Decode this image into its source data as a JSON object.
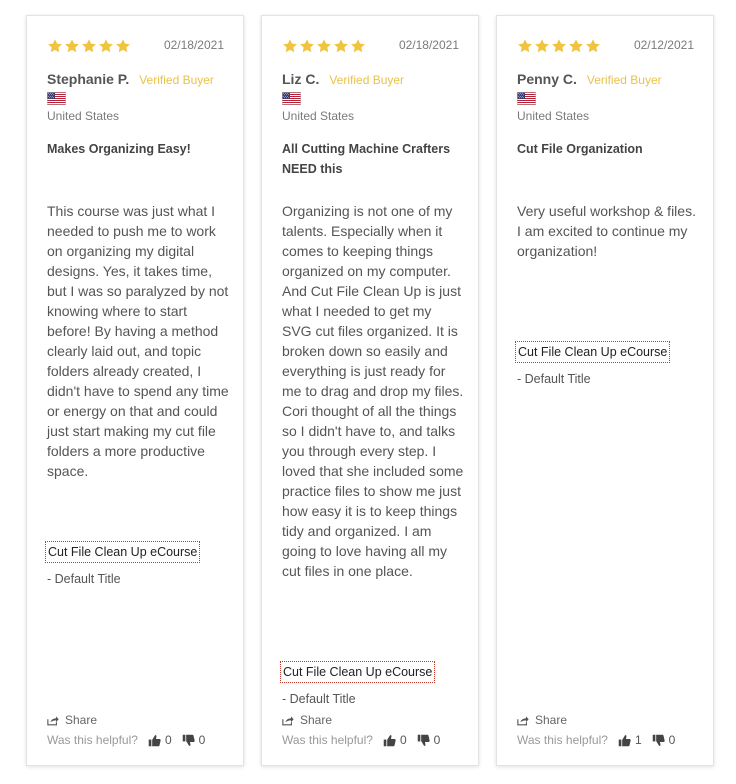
{
  "accent_color": "#e9c24b",
  "reviews": [
    {
      "stars": 5,
      "date": "02/18/2021",
      "name": "Stephanie P.",
      "verified": "Verified Buyer",
      "country": "United States",
      "title": "Makes Organizing Easy!",
      "body": "This course was just what I needed to push me to work on organizing my digital designs. Yes, it takes time, but I was so paralyzed by not knowing where to start before! By having a method clearly laid out, and topic folders already created, I didn't have to spend any time or energy on that and could just start making my cut file folders a more productive space.",
      "product": "Cut File Clean Up eCourse",
      "variant": "- Default Title",
      "share_label": "Share",
      "helpful_label": "Was this helpful?",
      "up_count": "0",
      "down_count": "0"
    },
    {
      "stars": 5,
      "date": "02/18/2021",
      "name": "Liz C.",
      "verified": "Verified Buyer",
      "country": "United States",
      "title": "All Cutting Machine Crafters NEED this",
      "body": "Organizing is not one of my talents. Especially when it comes to keeping things organized on my computer. And Cut File Clean Up is just what I needed to get my SVG cut files organized. It is broken down so easily and everything is just ready for me to drag and drop my files. Cori thought of all the things so I didn't have to, and talks you through every step. I loved that she included some practice files to show me just how easy it is to keep things tidy and organized. I am going to love having all my cut files in one place.",
      "product": "Cut File Clean Up eCourse",
      "variant": "- Default Title",
      "share_label": "Share",
      "helpful_label": "Was this helpful?",
      "up_count": "0",
      "down_count": "0"
    },
    {
      "stars": 5,
      "date": "02/12/2021",
      "name": "Penny C.",
      "verified": "Verified Buyer",
      "country": "United States",
      "title": "Cut File Organization",
      "body": "Very useful workshop & files. I am excited to continue my organization!",
      "product": "Cut File Clean Up eCourse",
      "variant": "- Default Title",
      "share_label": "Share",
      "helpful_label": "Was this helpful?",
      "up_count": "1",
      "down_count": "0"
    }
  ]
}
